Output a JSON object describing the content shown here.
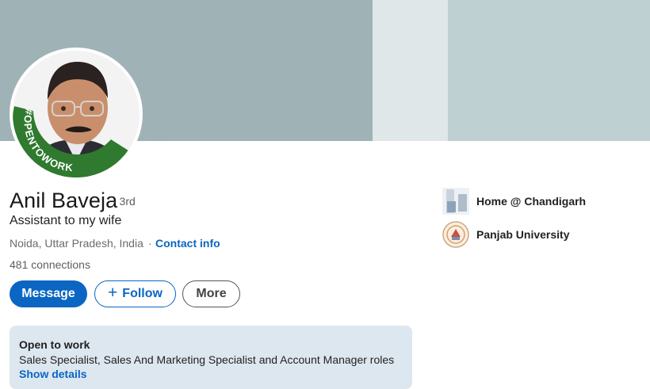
{
  "profile": {
    "name": "Anil Baveja",
    "degree": "· 3rd",
    "headline": "Assistant to my wife",
    "location": "Noida, Uttar Pradesh, India",
    "separator": "·",
    "contact_link": "Contact info",
    "connections": "481 connections",
    "avatar_badge": "#OPENTOWORK"
  },
  "actions": {
    "message_label": "Message",
    "follow_icon": "+",
    "follow_label": "Follow",
    "more_label": "More"
  },
  "open_to_work": {
    "title": "Open to work",
    "roles": "Sales Specialist, Sales And Marketing Specialist and Account Manager roles",
    "link": "Show details"
  },
  "sidebar": {
    "items": [
      {
        "label": "Home @ Chandigarh",
        "icon": "company-logo-icon"
      },
      {
        "label": "Panjab University",
        "icon": "university-seal-icon"
      }
    ]
  },
  "colors": {
    "accent": "#0a66c2",
    "open_to_work_green": "#2f7a2f",
    "card_bg": "#dde7f0"
  }
}
